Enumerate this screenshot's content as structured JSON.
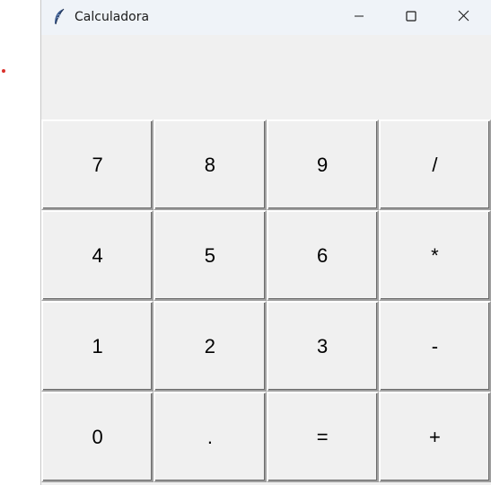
{
  "window": {
    "title": "Calculadora",
    "icon": "feather-icon"
  },
  "display": {
    "value": ""
  },
  "keys": [
    [
      "7",
      "8",
      "9",
      "/"
    ],
    [
      "4",
      "5",
      "6",
      "*"
    ],
    [
      "1",
      "2",
      "3",
      "-"
    ],
    [
      "0",
      ".",
      "=",
      "+"
    ]
  ],
  "colors": {
    "window_bg": "#f0f0f0",
    "titlebar_bg": "#eff3f8",
    "accent_dot": "#d9312b"
  }
}
